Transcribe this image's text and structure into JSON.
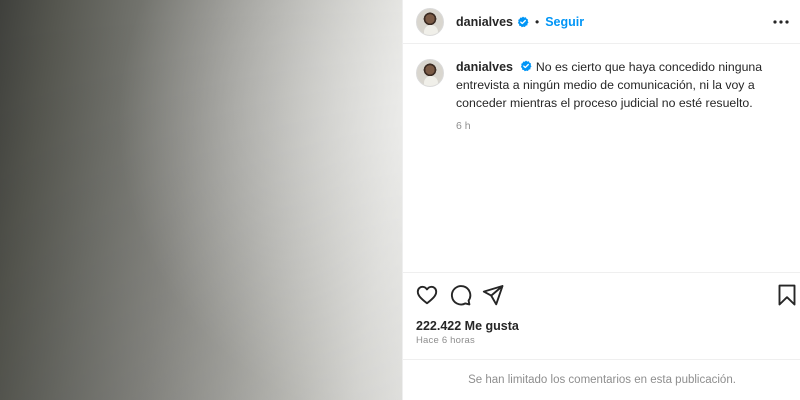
{
  "post": {
    "username": "danialves",
    "follow_label": "Seguir",
    "separator": "•",
    "caption_text": "No es cierto que haya concedido ninguna entrevista a ningún medio de comunicación, ni la voy a conceder mientras el proceso judicial no esté resuelto.",
    "caption_time": "6 h",
    "likes": "222.422 Me gusta",
    "posted_ago": "Hace 6 horas",
    "comments_disabled": "Se han limitado los comentarios en esta publicación."
  },
  "icons": {
    "verified": "verified-badge-icon",
    "more": "more-options-icon",
    "like": "heart-icon",
    "comment": "comment-icon",
    "share": "send-icon",
    "save": "bookmark-icon"
  },
  "colors": {
    "accent": "#0095f6",
    "text": "#262626",
    "muted": "#8e8e8e",
    "divider": "#efefef"
  }
}
